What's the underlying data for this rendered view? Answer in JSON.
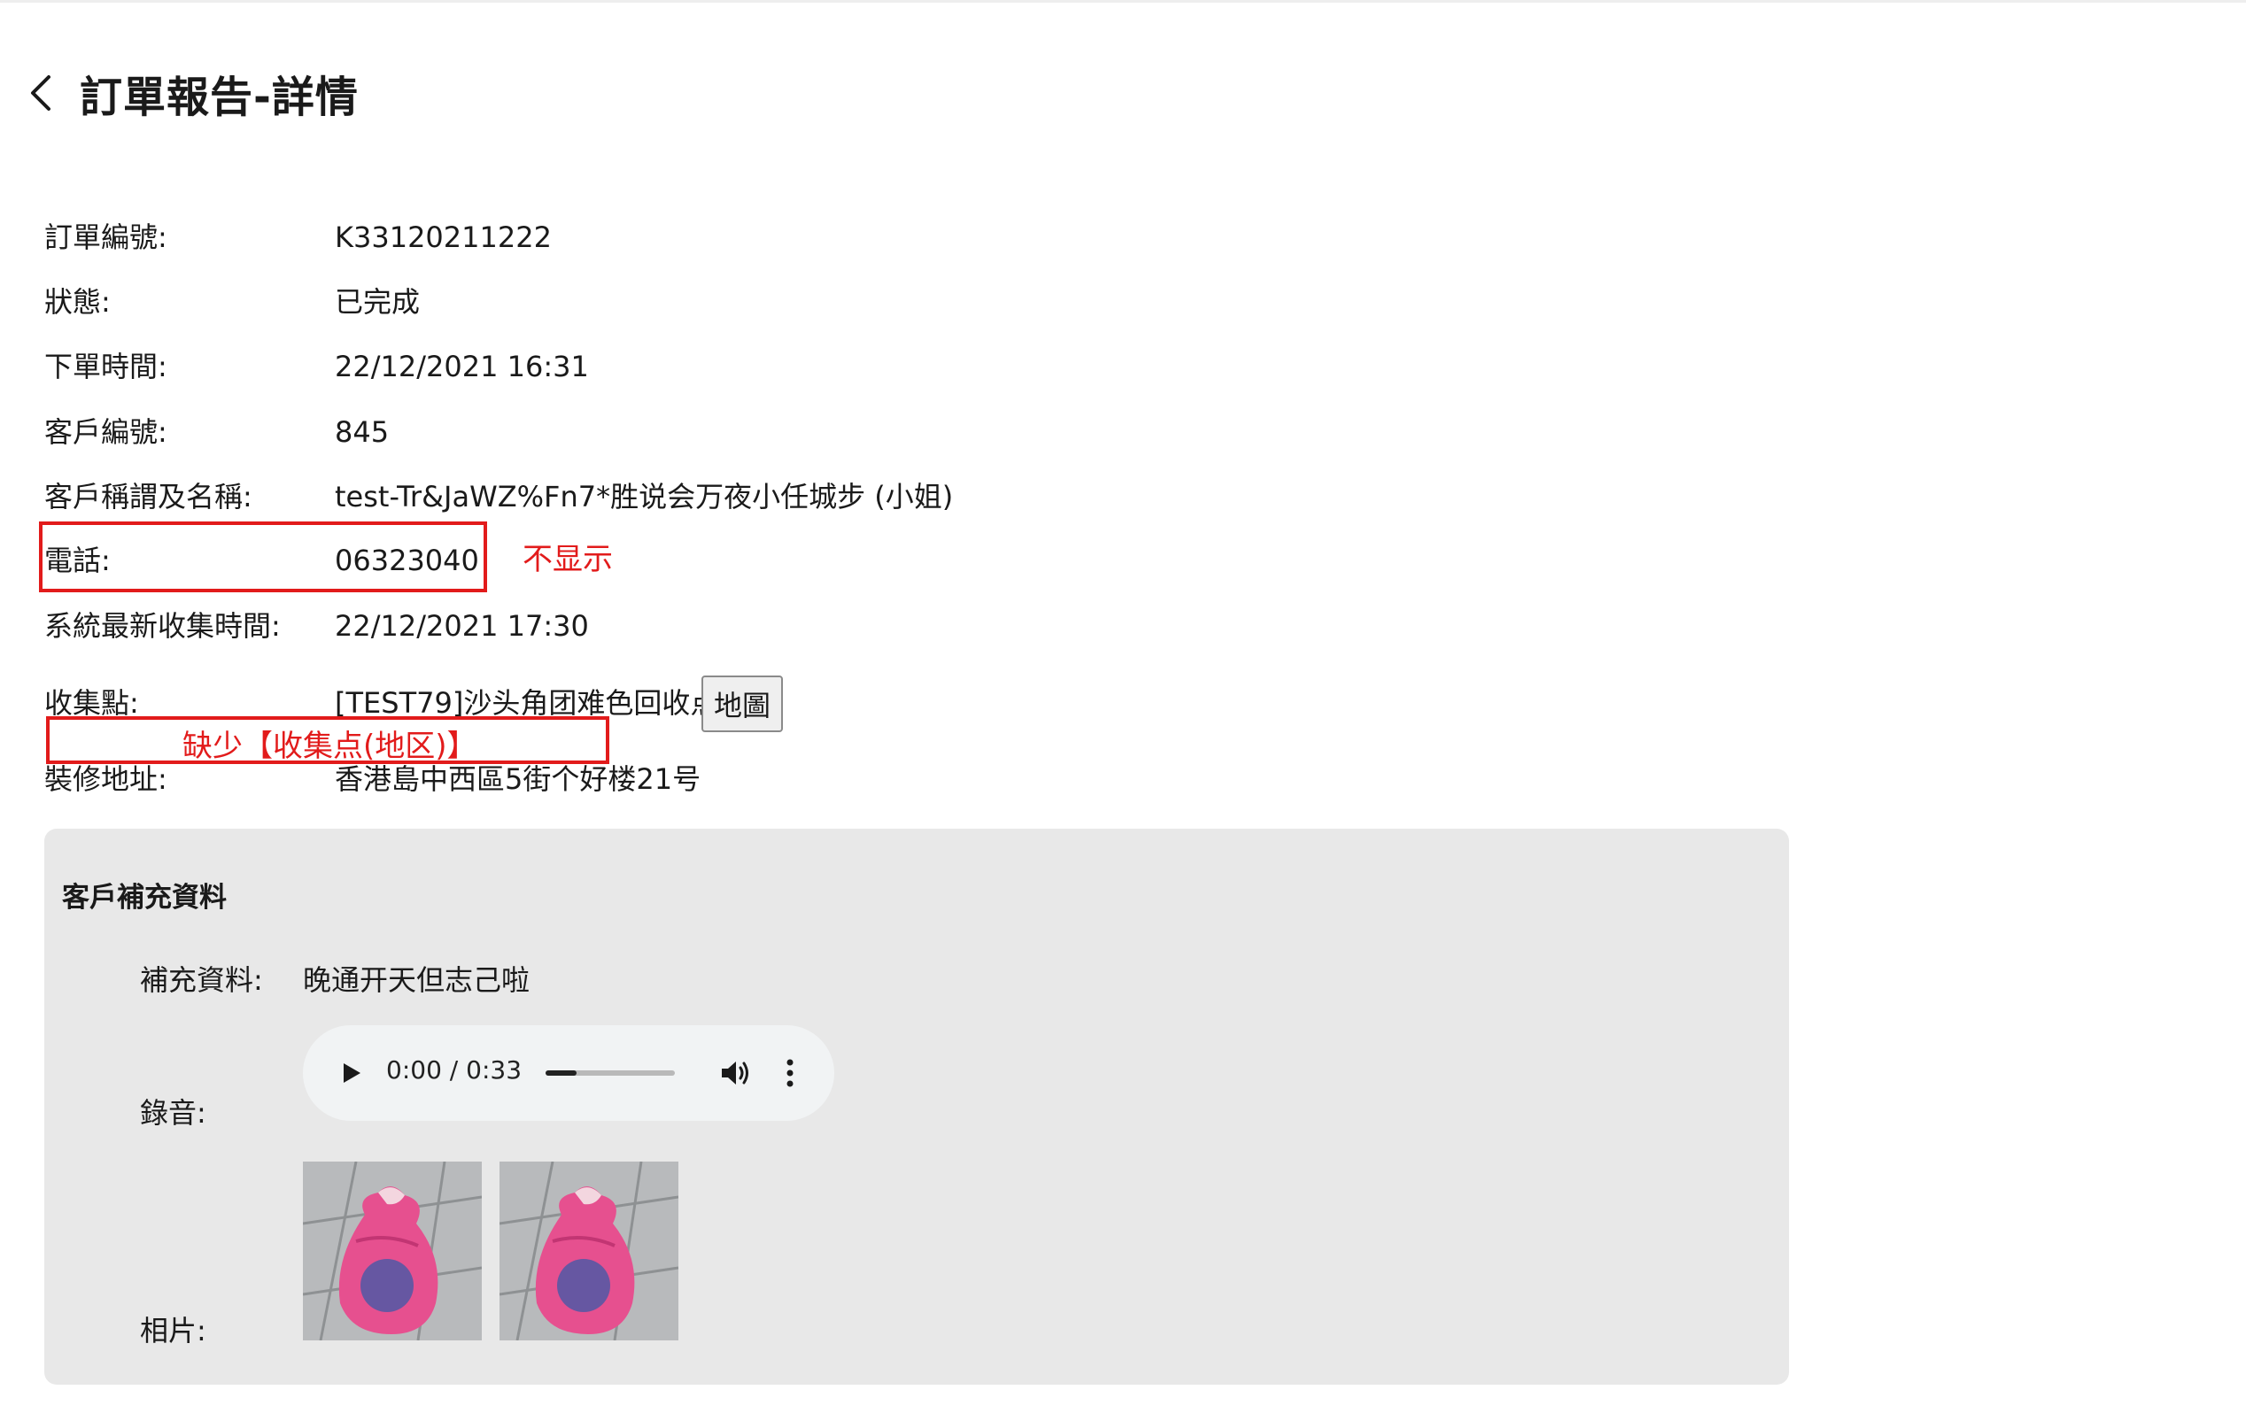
{
  "header": {
    "back_icon": "chevron-left-icon",
    "title": "訂單報告-詳情"
  },
  "order": {
    "number_label": "訂單編號:",
    "number_value": "K33120211222",
    "status_label": "狀態:",
    "status_value": "已完成",
    "order_time_label": "下單時間:",
    "order_time_value": "22/12/2021 16:31",
    "customer_id_label": "客戶編號:",
    "customer_id_value": "845",
    "customer_name_label": "客戶稱謂及名稱:",
    "customer_name_value": "test-Tr&JaWZ%Fn7*胜说会万夜小任城步 (小姐)",
    "phone_label": "電話:",
    "phone_value": "06323040",
    "latest_collection_label": "系統最新收集時間:",
    "latest_collection_value": "22/12/2021 17:30",
    "collection_point_label": "收集點:",
    "collection_point_value": "[TEST79]沙头角团难色回收点",
    "map_button_label": "地圖",
    "address_label": "裝修地址:",
    "address_value": "香港島中西區5街个好楼21号"
  },
  "annotations": {
    "phone_note": "不显示",
    "collection_note": "缺少【收集点(地区)】",
    "color": "#e21b1b"
  },
  "supplement": {
    "title": "客戶補充資料",
    "info_label": "補充資料:",
    "info_value": "晚通开天但志己啦",
    "recording_label": "錄音:",
    "audio": {
      "current_time": "0:00",
      "separator": "/",
      "duration": "0:33",
      "progress_fraction": 0.24
    },
    "photos_label": "相片:",
    "photos": [
      "photo-1",
      "photo-2"
    ]
  }
}
